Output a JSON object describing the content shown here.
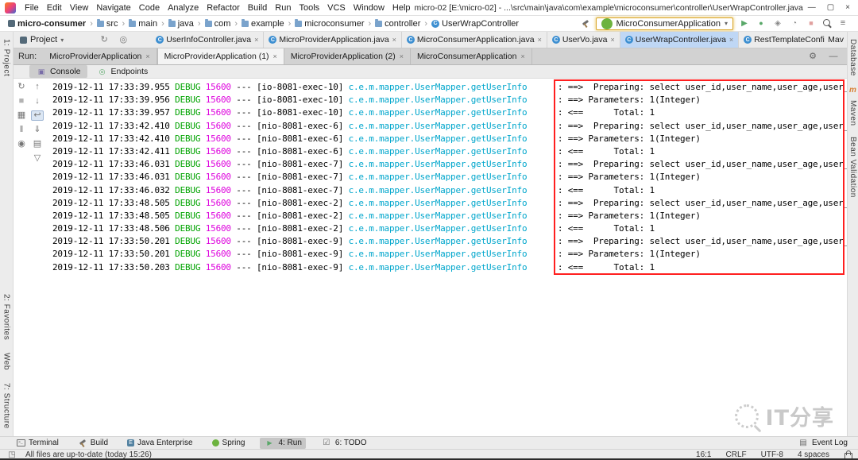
{
  "window": {
    "menu": [
      "File",
      "Edit",
      "View",
      "Navigate",
      "Code",
      "Analyze",
      "Refactor",
      "Build",
      "Run",
      "Tools",
      "VCS",
      "Window",
      "Help"
    ],
    "title": "micro-02 [E:\\micro-02] - ...\\src\\main\\java\\com\\example\\microconsumer\\controller\\UserWrapController.java [micro-consumer]",
    "controls": {
      "minimize": "—",
      "maximize": "▢",
      "close": "×"
    }
  },
  "navbar": {
    "crumbs": [
      "micro-consumer",
      "src",
      "main",
      "java",
      "com",
      "example",
      "microconsumer",
      "controller",
      "UserWrapController"
    ],
    "run_config": "MicroConsumerApplication",
    "pre_icons": [
      "build-icon"
    ],
    "post_icons": [
      "run-icon",
      "debug-icon",
      "coverage-icon",
      "profiler-icon",
      "stop-icon",
      "search-icon",
      "more-icon"
    ]
  },
  "editor": {
    "project_selector": "Project",
    "aux_icons": [
      "refresh-icon",
      "locate-icon"
    ],
    "tabs": [
      {
        "label": "UserInfoController.java",
        "active": false
      },
      {
        "label": "MicroProviderApplication.java",
        "active": false
      },
      {
        "label": "MicroConsumerApplication.java",
        "active": false
      },
      {
        "label": "UserVo.java",
        "active": false
      },
      {
        "label": "UserWrapController.java",
        "active": true
      },
      {
        "label": "RestTemplateConfiguration.java",
        "active": false
      }
    ],
    "overflow_tab": "Mav"
  },
  "run_panel": {
    "label": "Run:",
    "tabs": [
      {
        "label": "MicroProviderApplication",
        "active": false
      },
      {
        "label": "MicroProviderApplication (1)",
        "active": true
      },
      {
        "label": "MicroProviderApplication (2)",
        "active": false
      },
      {
        "label": "MicroConsumerApplication",
        "active": false
      }
    ],
    "header_icons": [
      "gear-icon",
      "minimize-icon"
    ],
    "view_tabs": [
      {
        "label": "Console",
        "icon": "console-icon",
        "active": true
      },
      {
        "label": "Endpoints",
        "icon": "endpoints-icon",
        "active": false
      }
    ],
    "toolbar_icons": [
      {
        "icon": "rerun-icon"
      },
      {
        "icon": "stop-icon"
      },
      {
        "icon": "restore-layout-icon"
      },
      {
        "icon": "pause-output-icon"
      },
      {
        "icon": "pin-icon"
      }
    ],
    "console_icons": [
      {
        "icon": "up-stack-icon"
      },
      {
        "icon": "down-stack-icon"
      },
      {
        "icon": "soft-wrap-icon",
        "selected": true
      },
      {
        "icon": "scroll-to-end-icon"
      },
      {
        "icon": "print-icon"
      },
      {
        "icon": "clear-all-icon"
      }
    ]
  },
  "console": {
    "level": "DEBUG",
    "pid": "15600",
    "sep": "---",
    "logger": "c.e.m.mapper.UserMapper.getUserInfo",
    "messages": {
      "preparing": "      : ==>  Preparing: select user_id,user_name,user_age,user_birth",
      "parameters": "      : ==> Parameters: 1(Integer)",
      "total": "      : <==      Total: 1"
    },
    "lines": [
      {
        "time": "2019-12-11 17:33:39.955",
        "thread": "[io-8081-exec-10]",
        "message": "preparing"
      },
      {
        "time": "2019-12-11 17:33:39.956",
        "thread": "[io-8081-exec-10]",
        "message": "parameters"
      },
      {
        "time": "2019-12-11 17:33:39.957",
        "thread": "[io-8081-exec-10]",
        "message": "total"
      },
      {
        "time": "2019-12-11 17:33:42.410",
        "thread": "[nio-8081-exec-6]",
        "message": "preparing"
      },
      {
        "time": "2019-12-11 17:33:42.410",
        "thread": "[nio-8081-exec-6]",
        "message": "parameters"
      },
      {
        "time": "2019-12-11 17:33:42.411",
        "thread": "[nio-8081-exec-6]",
        "message": "total"
      },
      {
        "time": "2019-12-11 17:33:46.031",
        "thread": "[nio-8081-exec-7]",
        "message": "preparing"
      },
      {
        "time": "2019-12-11 17:33:46.031",
        "thread": "[nio-8081-exec-7]",
        "message": "parameters"
      },
      {
        "time": "2019-12-11 17:33:46.032",
        "thread": "[nio-8081-exec-7]",
        "message": "total"
      },
      {
        "time": "2019-12-11 17:33:48.505",
        "thread": "[nio-8081-exec-2]",
        "message": "preparing"
      },
      {
        "time": "2019-12-11 17:33:48.505",
        "thread": "[nio-8081-exec-2]",
        "message": "parameters"
      },
      {
        "time": "2019-12-11 17:33:48.506",
        "thread": "[nio-8081-exec-2]",
        "message": "total"
      },
      {
        "time": "2019-12-11 17:33:50.201",
        "thread": "[nio-8081-exec-9]",
        "message": "preparing"
      },
      {
        "time": "2019-12-11 17:33:50.201",
        "thread": "[nio-8081-exec-9]",
        "message": "parameters"
      },
      {
        "time": "2019-12-11 17:33:50.203",
        "thread": "[nio-8081-exec-9]",
        "message": "total"
      }
    ]
  },
  "stripes": {
    "left_top": [
      {
        "label": "1: Project"
      }
    ],
    "left_bottom": [
      {
        "label": "2: Favorites"
      },
      {
        "label": "Web"
      },
      {
        "label": "7: Structure"
      }
    ],
    "right": [
      {
        "label": "Database"
      },
      {
        "label": "Maven",
        "icon": "maven-icon"
      },
      {
        "label": "Bean Validation"
      }
    ]
  },
  "bottom_bar": {
    "items": [
      {
        "label": "Terminal",
        "icon": "terminal-icon",
        "active": false
      },
      {
        "label": "Build",
        "icon": "build-icon",
        "active": false
      },
      {
        "label": "Java Enterprise",
        "icon": "javaee-icon",
        "active": false
      },
      {
        "label": "Spring",
        "icon": "spring-icon",
        "active": false
      },
      {
        "label": "4: Run",
        "icon": "run-tool-icon",
        "active": true
      },
      {
        "label": "6: TODO",
        "icon": "todo-icon",
        "active": false
      }
    ],
    "right_item": {
      "label": "Event Log",
      "icon": "event-log-icon"
    }
  },
  "status_bar": {
    "message": "All files are up-to-date (today 15:26)",
    "caret": "16:1",
    "line_ending": "CRLF",
    "encoding": "UTF-8",
    "indent": "4 spaces"
  },
  "watermark": {
    "text": "IT分享"
  },
  "colors": {
    "debug_green": "#00A300",
    "pid_magenta": "#DD00DD",
    "logger_cyan": "#00A6CC",
    "annotation_red": "#FF1F1F",
    "active_tab_blue": "#BFD7F5",
    "run_green": "#59A869",
    "stop_red": "#C75450"
  }
}
